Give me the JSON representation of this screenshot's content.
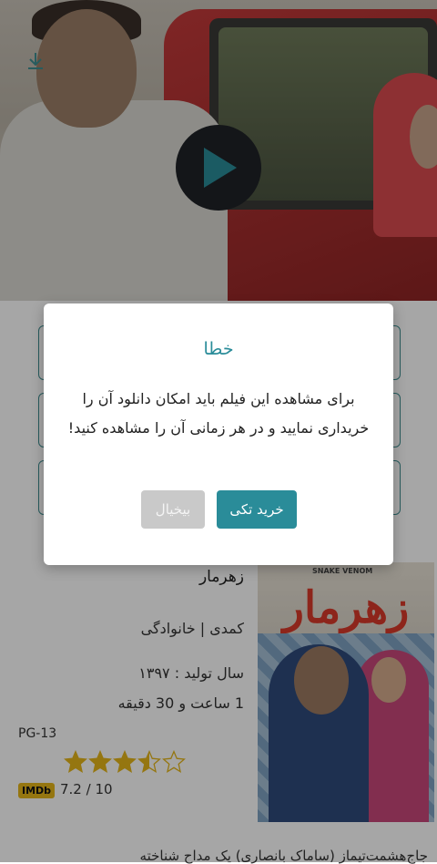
{
  "hero": {
    "play_icon": "play-icon",
    "download_icon": "download-icon"
  },
  "film": {
    "title": "زهرمار",
    "genre": "کمدی | خانوادگی",
    "year": "سال تولید : ۱۳۹۷",
    "duration": "1 ساعت و  30 دقیقه",
    "age_rating": "PG-13",
    "stars": 3.5,
    "imdb_label": "IMDb",
    "imdb_score": "7.2 / 10",
    "description": "جاج‌هشمت‌تیماز (ساماک بانصاری) یک مداح شناخته"
  },
  "poster": {
    "top_text": "SNAKE VENOM",
    "logo_text": "زهرمار"
  },
  "dialog": {
    "title": "خطا",
    "message": "برای مشاهده این فیلم باید امکان دانلود آن را خریداری نمایید و در هر زمانی آن را مشاهده کنید!",
    "buy_label": "خرید تکی",
    "cancel_label": "بیخیال"
  },
  "colors": {
    "accent": "#2a8c99",
    "cancel": "#c9c9c9",
    "star": "#e5b61a"
  }
}
